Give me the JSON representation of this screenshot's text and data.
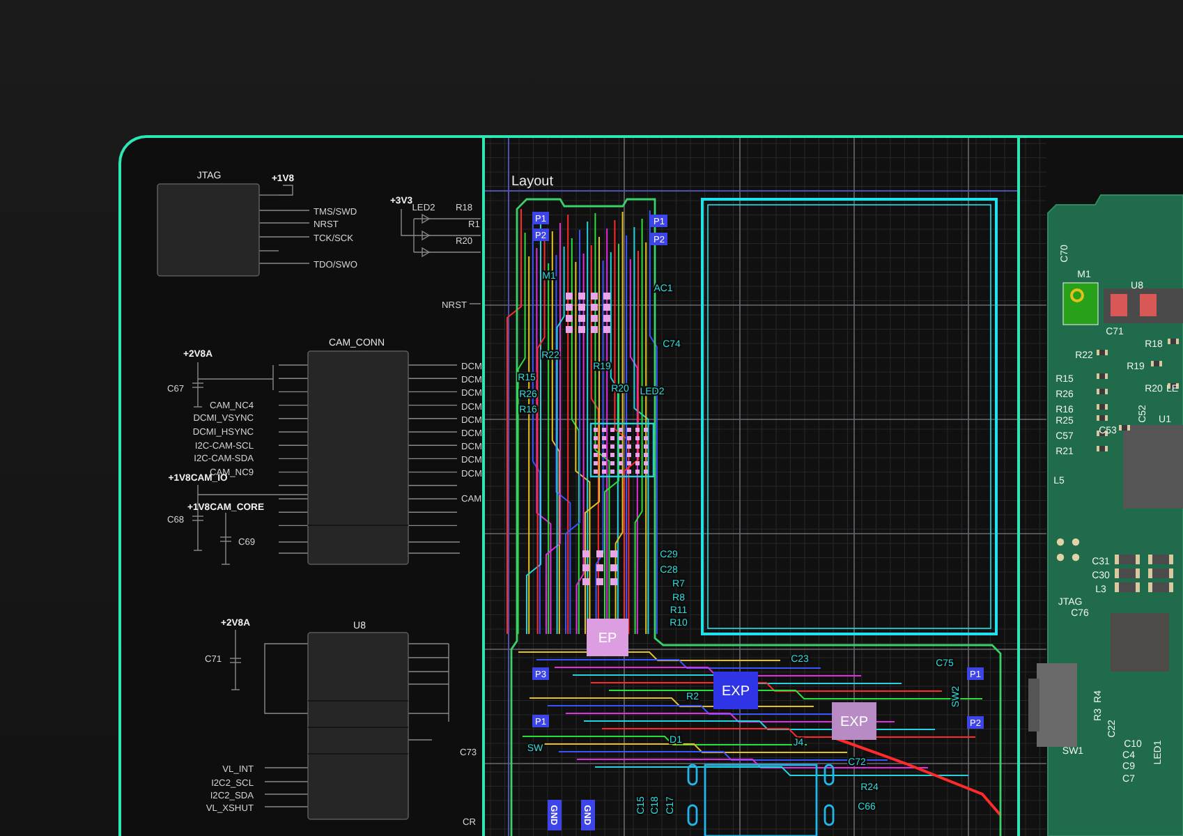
{
  "schematic": {
    "blocks": [
      {
        "title": "JTAG"
      },
      {
        "title": "CAM_CONN"
      },
      {
        "title": "U8"
      }
    ],
    "labels": [
      {
        "text": "+1V8",
        "kind": "power"
      },
      {
        "text": "TMS/SWD",
        "kind": "net"
      },
      {
        "text": "NRST",
        "kind": "net"
      },
      {
        "text": "TCK/SCK",
        "kind": "net"
      },
      {
        "text": "TDO/SWO",
        "kind": "net"
      },
      {
        "text": "+3V3",
        "kind": "power"
      },
      {
        "text": "LED2",
        "kind": "ref"
      },
      {
        "text": "R18",
        "kind": "ref"
      },
      {
        "text": "R1",
        "kind": "ref"
      },
      {
        "text": "R20",
        "kind": "ref"
      },
      {
        "text": "NRST",
        "kind": "net"
      },
      {
        "text": "+2V8A",
        "kind": "power"
      },
      {
        "text": "C67",
        "kind": "ref"
      },
      {
        "text": "CAM_NC4",
        "kind": "net"
      },
      {
        "text": "DCMI_VSYNC",
        "kind": "net"
      },
      {
        "text": "DCMI_HSYNC",
        "kind": "net"
      },
      {
        "text": "I2C-CAM-SCL",
        "kind": "net"
      },
      {
        "text": "I2C-CAM-SDA",
        "kind": "net"
      },
      {
        "text": "CAM_NC9",
        "kind": "net"
      },
      {
        "text": "+1V8CAM_IO",
        "kind": "power"
      },
      {
        "text": "+1V8CAM_CORE",
        "kind": "power"
      },
      {
        "text": "C68",
        "kind": "ref"
      },
      {
        "text": "C69",
        "kind": "ref"
      },
      {
        "text": "DCM",
        "kind": "net"
      },
      {
        "text": "DCM",
        "kind": "net"
      },
      {
        "text": "DCM",
        "kind": "net"
      },
      {
        "text": "DCM",
        "kind": "net"
      },
      {
        "text": "DCM",
        "kind": "net"
      },
      {
        "text": "DCM",
        "kind": "net"
      },
      {
        "text": "DCM",
        "kind": "net"
      },
      {
        "text": "DCM",
        "kind": "net"
      },
      {
        "text": "DCM",
        "kind": "net"
      },
      {
        "text": "CAM",
        "kind": "net"
      },
      {
        "text": "+2V8A",
        "kind": "power"
      },
      {
        "text": "C71",
        "kind": "ref"
      },
      {
        "text": "VL_INT",
        "kind": "net"
      },
      {
        "text": "I2C2_SCL",
        "kind": "net"
      },
      {
        "text": "I2C2_SDA",
        "kind": "net"
      },
      {
        "text": "VL_XSHUT",
        "kind": "net"
      },
      {
        "text": "C73",
        "kind": "ref"
      },
      {
        "text": "CR",
        "kind": "ref"
      }
    ]
  },
  "layout": {
    "title": "Layout",
    "labels": [
      {
        "text": "P1",
        "kind": "pad"
      },
      {
        "text": "P2",
        "kind": "pad"
      },
      {
        "text": "P1",
        "kind": "pad"
      },
      {
        "text": "P2",
        "kind": "pad"
      },
      {
        "text": "M1",
        "kind": "silk"
      },
      {
        "text": "AC1",
        "kind": "silk"
      },
      {
        "text": "C74",
        "kind": "silk"
      },
      {
        "text": "R22",
        "kind": "silk"
      },
      {
        "text": "R19",
        "kind": "silk"
      },
      {
        "text": "R15",
        "kind": "silk"
      },
      {
        "text": "R26",
        "kind": "silk"
      },
      {
        "text": "R16",
        "kind": "silk"
      },
      {
        "text": "R20",
        "kind": "silk"
      },
      {
        "text": "LED2",
        "kind": "silk"
      },
      {
        "text": "C29",
        "kind": "silk"
      },
      {
        "text": "C28",
        "kind": "silk"
      },
      {
        "text": "R7",
        "kind": "silk"
      },
      {
        "text": "R8",
        "kind": "silk"
      },
      {
        "text": "R11",
        "kind": "silk"
      },
      {
        "text": "R10",
        "kind": "silk"
      },
      {
        "text": "EP",
        "kind": "chip",
        "color": "#dc9ee0"
      },
      {
        "text": "EXP",
        "kind": "chip",
        "color": "#2f35e6"
      },
      {
        "text": "EXP",
        "kind": "chip",
        "color": "#b98bc4"
      },
      {
        "text": "P3",
        "kind": "pad"
      },
      {
        "text": "P1",
        "kind": "pad"
      },
      {
        "text": "SW",
        "kind": "silk"
      },
      {
        "text": "C23",
        "kind": "silk"
      },
      {
        "text": "C75",
        "kind": "silk"
      },
      {
        "text": "SW2",
        "kind": "vertical"
      },
      {
        "text": "P1",
        "kind": "pad"
      },
      {
        "text": "P2",
        "kind": "pad"
      },
      {
        "text": "R2",
        "kind": "silk"
      },
      {
        "text": "D1",
        "kind": "silk"
      },
      {
        "text": "J4",
        "kind": "silk"
      },
      {
        "text": "C72",
        "kind": "silk"
      },
      {
        "text": "R24",
        "kind": "silk"
      },
      {
        "text": "C66",
        "kind": "silk"
      },
      {
        "text": "C15",
        "kind": "vertical"
      },
      {
        "text": "C18",
        "kind": "vertical"
      },
      {
        "text": "C17",
        "kind": "vertical"
      },
      {
        "text": "GND",
        "kind": "gnd"
      },
      {
        "text": "GND",
        "kind": "gnd"
      }
    ]
  },
  "board_3d": {
    "labels": [
      {
        "text": "C70",
        "kind": "vertical"
      },
      {
        "text": "M1",
        "kind": "ref"
      },
      {
        "text": "U8",
        "kind": "ref"
      },
      {
        "text": "C71",
        "kind": "ref"
      },
      {
        "text": "R18",
        "kind": "ref"
      },
      {
        "text": "R22",
        "kind": "ref"
      },
      {
        "text": "R19",
        "kind": "ref"
      },
      {
        "text": "R15",
        "kind": "ref"
      },
      {
        "text": "R20",
        "kind": "ref"
      },
      {
        "text": "LE",
        "kind": "ref"
      },
      {
        "text": "R26",
        "kind": "ref"
      },
      {
        "text": "R16",
        "kind": "ref"
      },
      {
        "text": "R25",
        "kind": "ref"
      },
      {
        "text": "C52",
        "kind": "vertical"
      },
      {
        "text": "U1",
        "kind": "ref"
      },
      {
        "text": "C53",
        "kind": "ref"
      },
      {
        "text": "C57",
        "kind": "ref"
      },
      {
        "text": "R21",
        "kind": "ref"
      },
      {
        "text": "L5",
        "kind": "ref"
      },
      {
        "text": "C31",
        "kind": "ref"
      },
      {
        "text": "C30",
        "kind": "ref"
      },
      {
        "text": "L3",
        "kind": "ref"
      },
      {
        "text": "JTAG",
        "kind": "ref"
      },
      {
        "text": "C76",
        "kind": "ref"
      },
      {
        "text": "SW1",
        "kind": "ref"
      },
      {
        "text": "R4",
        "kind": "vertical"
      },
      {
        "text": "R3",
        "kind": "vertical"
      },
      {
        "text": "C22",
        "kind": "vertical"
      },
      {
        "text": "C10",
        "kind": "ref"
      },
      {
        "text": "C4",
        "kind": "ref"
      },
      {
        "text": "C9",
        "kind": "ref"
      },
      {
        "text": "C7",
        "kind": "ref"
      },
      {
        "text": "LED1",
        "kind": "vertical"
      }
    ]
  }
}
